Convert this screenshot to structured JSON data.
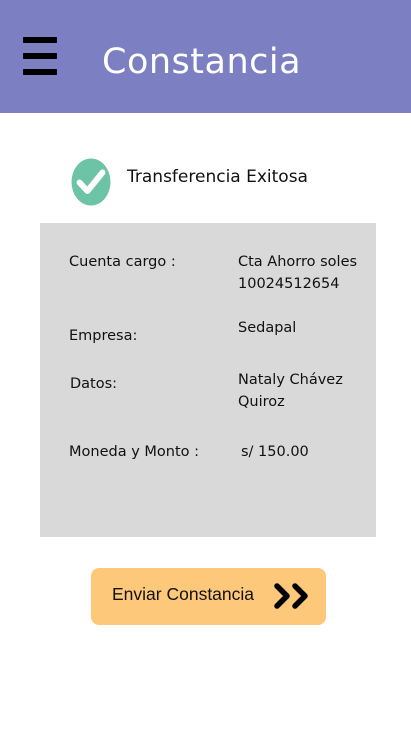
{
  "header": {
    "title": "Constancia",
    "background_color": "#7c7fc2",
    "menu_icon": "hamburger-menu-icon"
  },
  "status": {
    "text": "Transferencia Exitosa",
    "icon": "check-circle-icon",
    "icon_color": "#6cc3a5"
  },
  "details": {
    "rows": [
      {
        "label": "Cuenta cargo :",
        "value_line1": "Cta Ahorro soles",
        "value_line2": "10024512654"
      },
      {
        "label": "Empresa:",
        "value_line1": "Sedapal"
      },
      {
        "label": "Datos:",
        "value_line1": "Nataly Chávez",
        "value_line2": "Quiroz"
      },
      {
        "label": "Moneda y Monto :",
        "value_line1": "s/ 150.00"
      }
    ],
    "background_color": "#d9d9d9"
  },
  "action": {
    "send_label": "Enviar Constancia",
    "icon": "double-chevron-right-icon",
    "background_color": "#fec87a"
  }
}
